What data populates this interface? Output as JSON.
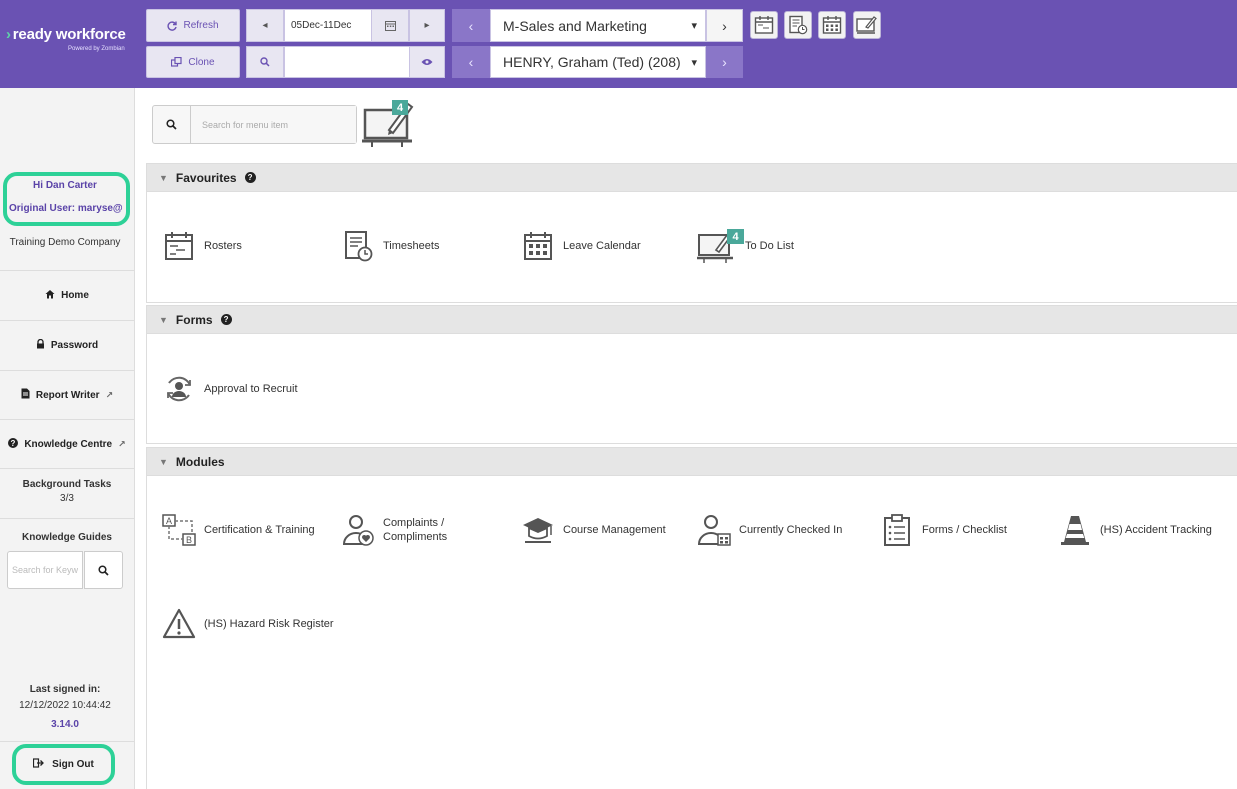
{
  "brand": {
    "name": "ready workforce",
    "powered": "Powered by Zombian"
  },
  "topbar": {
    "refresh_label": "Refresh",
    "clone_label": "Clone",
    "date_range": "05Dec-11Dec",
    "search_value": "",
    "department_select": "M-Sales and Marketing",
    "employee_select": "HENRY, Graham (Ted) (208)",
    "todo_count": "4"
  },
  "sidebar": {
    "greeting": "Hi Dan Carter",
    "original_user": "Original User: maryse@",
    "company": "Training Demo Company",
    "nav": [
      {
        "label": "Home",
        "icon": "home-icon"
      },
      {
        "label": "Password",
        "icon": "lock-icon"
      },
      {
        "label": "Report Writer",
        "icon": "file-icon"
      },
      {
        "label": "Knowledge Centre",
        "icon": "help-icon"
      }
    ],
    "background_tasks_label": "Background Tasks",
    "background_tasks_count": "3/3",
    "knowledge_guides_label": "Knowledge Guides",
    "knowledge_search_placeholder": "Search for Keyw",
    "last_signed_label": "Last signed in:",
    "last_signed_value": "12/12/2022 10:44:42",
    "version": "3.14.0",
    "sign_out_label": "Sign Out"
  },
  "main": {
    "menu_search_placeholder": "Search for menu item",
    "todo_badge": "4",
    "favourites": {
      "title": "Favourites",
      "items": [
        "Rosters",
        "Timesheets",
        "Leave Calendar",
        "To Do List"
      ],
      "todo_badge": "4"
    },
    "forms": {
      "title": "Forms",
      "items": [
        "Approval to Recruit"
      ]
    },
    "modules": {
      "title": "Modules",
      "items": [
        "Certification & Training",
        "Complaints / Compliments",
        "Course Management",
        "Currently Checked In",
        "Forms / Checklist",
        "(HS) Accident Tracking",
        "(HS) Hazard Risk Register"
      ]
    }
  },
  "colors": {
    "primary": "#6a52b3",
    "highlight": "#2dd197",
    "badge": "#4aa89a"
  }
}
